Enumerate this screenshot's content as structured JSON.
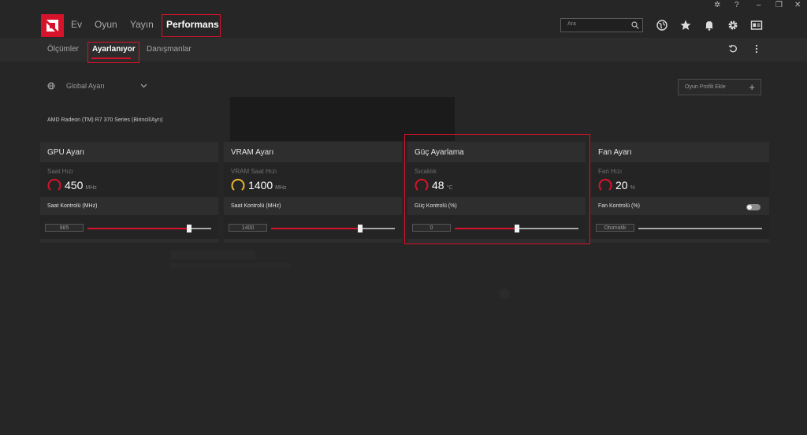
{
  "header": {
    "nav": [
      "Ev",
      "Oyun",
      "Yayın",
      "Performans"
    ],
    "search_placeholder": "Ara"
  },
  "subnav": {
    "tabs": [
      "Ölçümler",
      "Ayarlanıyor",
      "Danışmanlar"
    ]
  },
  "content": {
    "profile_label": "Global Ayarı",
    "gpu_name": "AMD Radeon (TM) R7 370 Series (Birincil/Ayrı)",
    "add_profile_label": "Oyun Profili Ekle"
  },
  "panels": [
    {
      "title": "GPU Ayarı",
      "metric_label": "Saat Hızı",
      "metric_value": "450",
      "metric_unit": "MHz",
      "gauge_color": "#d6132a",
      "control_label": "Saat Kontrolü (MHz)",
      "control_value": "985",
      "slider_fraction": 0.82
    },
    {
      "title": "VRAM Ayarı",
      "metric_label": "VRAM Saat Hızı",
      "metric_value": "1400",
      "metric_unit": "MHz",
      "gauge_color": "#e8b52c",
      "control_label": "Saat Kontrolü (MHz)",
      "control_value": "1400",
      "slider_fraction": 0.72
    },
    {
      "title": "Güç Ayarlama",
      "metric_label": "Sıcaklık",
      "metric_value": "48",
      "metric_unit": "°C",
      "gauge_color": "#d6132a",
      "control_label": "Güç Kontrolü (%)",
      "control_value": "0",
      "slider_fraction": 0.5
    },
    {
      "title": "Fan Ayarı",
      "metric_label": "Fan Hızı",
      "metric_value": "20",
      "metric_unit": "%",
      "gauge_color": "#d6132a",
      "control_label": "Fan Kontrolü (%)",
      "control_value": "Otomatik",
      "slider_fraction": 0
    }
  ],
  "colors": {
    "accent": "#d6132a",
    "background": "#262626",
    "panel": "#2e2e2e"
  }
}
